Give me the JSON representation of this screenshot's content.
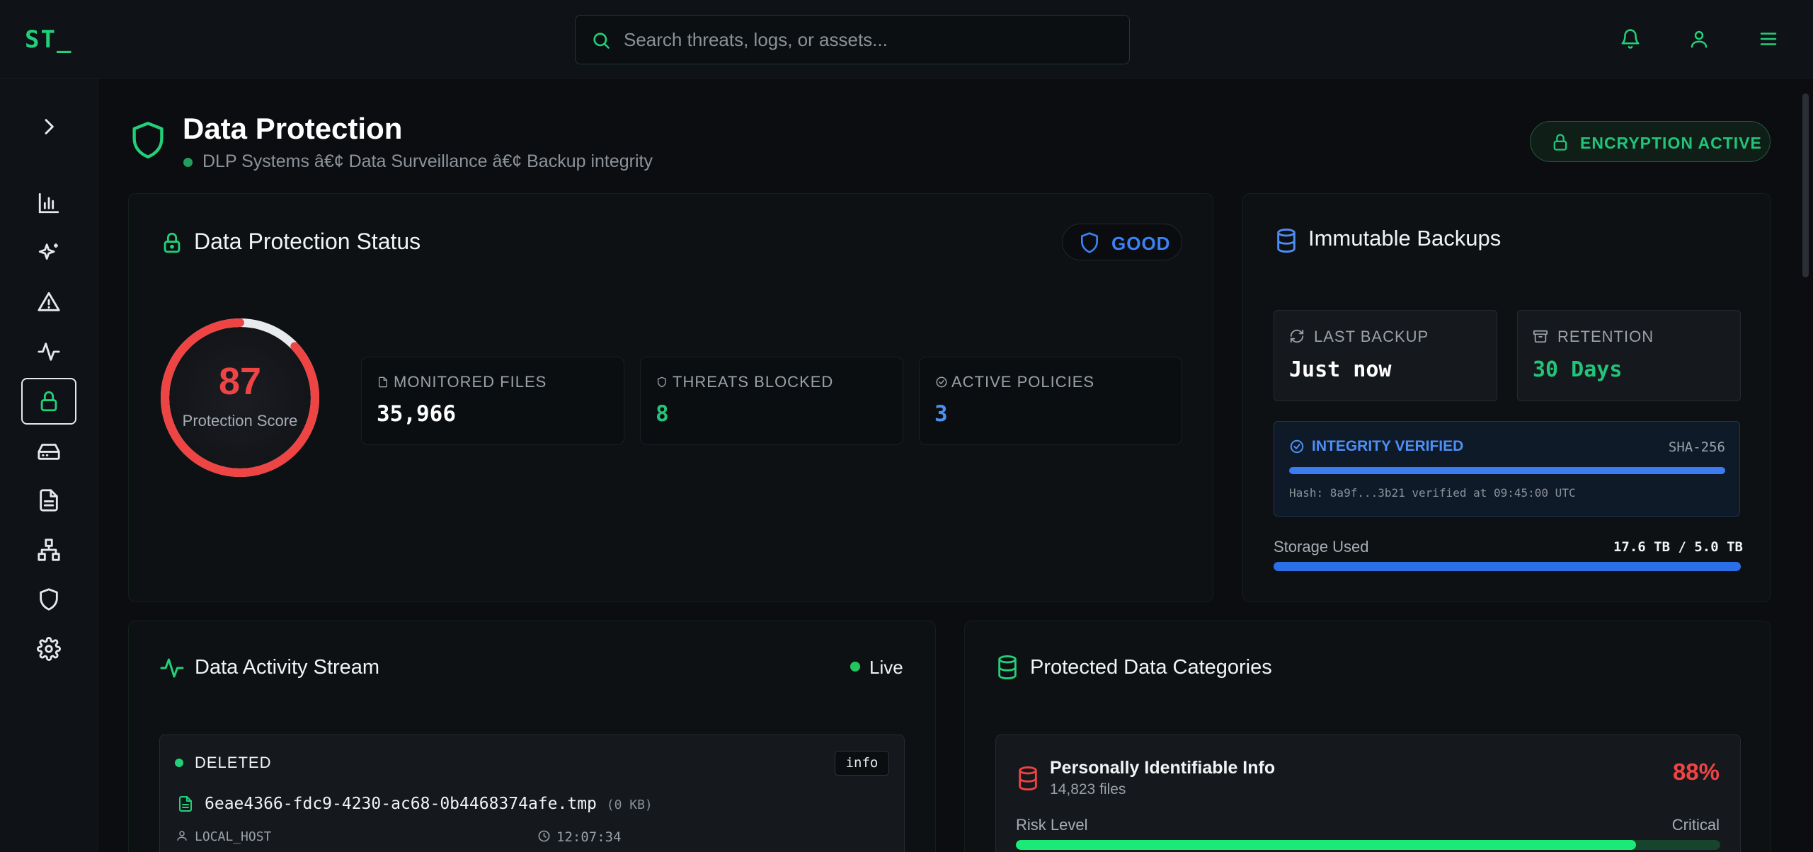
{
  "app": {
    "logo": "ST_"
  },
  "search": {
    "placeholder": "Search threats, logs, or assets..."
  },
  "sidebar": {
    "items": [
      {
        "icon": "chevron-right-icon"
      },
      {
        "icon": "bar-chart-icon"
      },
      {
        "icon": "sparkles-icon"
      },
      {
        "icon": "alert-triangle-icon"
      },
      {
        "icon": "activity-icon"
      },
      {
        "icon": "lock-icon",
        "active": true
      },
      {
        "icon": "hard-drive-icon"
      },
      {
        "icon": "file-text-icon"
      },
      {
        "icon": "network-icon"
      },
      {
        "icon": "shield-icon"
      },
      {
        "icon": "gear-icon"
      }
    ]
  },
  "header": {
    "title": "Data Protection",
    "subtitle": "DLP Systems â€¢ Data Surveillance â€¢ Backup integrity",
    "encryption_badge": "ENCRYPTION ACTIVE"
  },
  "status_card": {
    "title": "Data Protection Status",
    "badge": "GOOD",
    "score": "87",
    "score_label": "Protection Score",
    "score_fraction": 0.87,
    "stats": [
      {
        "label": "MONITORED FILES",
        "value": "35,966",
        "color": "#ffffff"
      },
      {
        "label": "THREATS BLOCKED",
        "value": "8",
        "color": "#22c47a"
      },
      {
        "label": "ACTIVE POLICIES",
        "value": "3",
        "color": "#4d8ff6"
      }
    ]
  },
  "backups_card": {
    "title": "Immutable Backups",
    "last_backup_label": "LAST BACKUP",
    "last_backup_value": "Just now",
    "retention_label": "RETENTION",
    "retention_value": "30 Days",
    "integrity_title": "INTEGRITY VERIFIED",
    "integrity_algo": "SHA-256",
    "integrity_note": "Hash: 8a9f...3b21 verified at 09:45:00 UTC",
    "storage_label": "Storage Used",
    "storage_value": "17.6 TB / 5.0 TB"
  },
  "activity_card": {
    "title": "Data Activity Stream",
    "live_label": "Live",
    "events": [
      {
        "type": "DELETED",
        "severity": "info",
        "file": "6eae4366-fdc9-4230-ac68-0b4468374afe.tmp",
        "size": "(0 KB)",
        "host": "LOCAL_HOST",
        "time": "12:07:34"
      }
    ]
  },
  "categories_card": {
    "title": "Protected Data Categories",
    "items": [
      {
        "name": "Personally Identifiable Info",
        "files": "14,823 files",
        "percent": "88%",
        "risk_label": "Risk Level",
        "risk_value": "Critical",
        "risk_fraction": 0.88
      }
    ]
  },
  "colors": {
    "accent": "#22d07a",
    "danger": "#ef4444",
    "info": "#3b82f6"
  }
}
